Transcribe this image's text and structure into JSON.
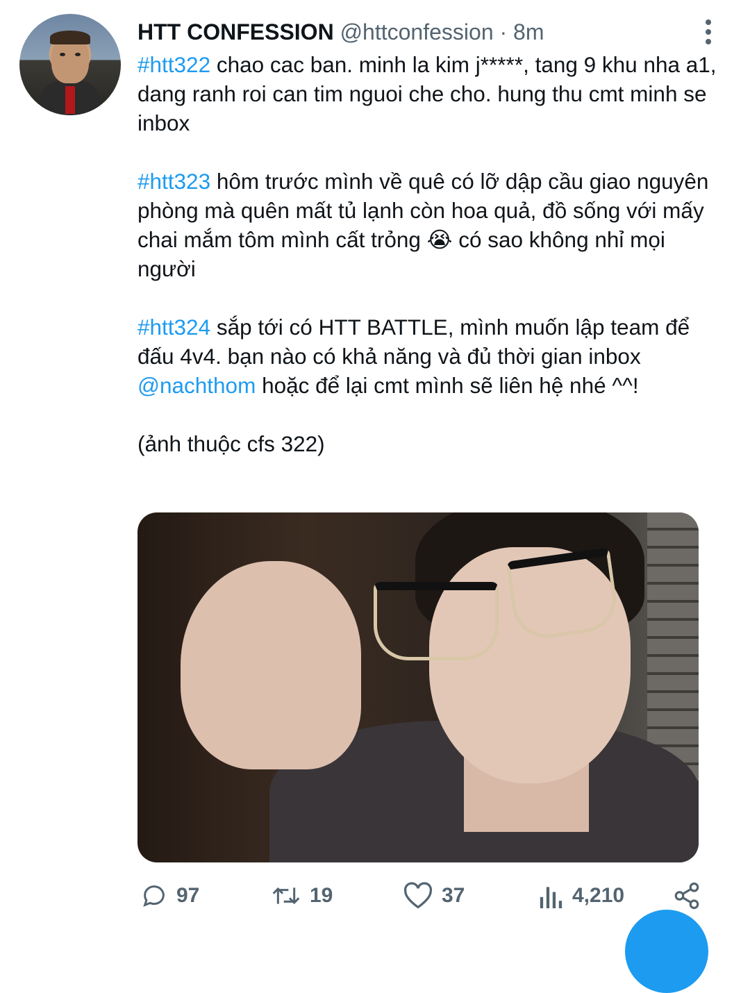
{
  "tweet": {
    "author_name": "HTT CONFESSION",
    "handle": "@httconfession",
    "separator": "·",
    "time": "8m",
    "paragraphs": [
      {
        "tag": "#htt322",
        "text": " chao cac ban. minh la kim j*****, tang 9 khu nha a1, dang ranh roi can tim nguoi che cho. hung thu cmt minh se inbox"
      },
      {
        "tag": "#htt323",
        "text": " hôm trước mình về quê có lỡ dập cầu giao nguyên phòng mà quên mất tủ lạnh còn hoa quả, đồ sống với mấy chai mắm tôm mình cất trỏng 😭 có sao không nhỉ mọi người"
      },
      {
        "tag": "#htt324",
        "text_before": " sắp tới có HTT BATTLE, mình muốn lập team để đấu 4v4. bạn nào có khả năng và đủ thời gian inbox ",
        "mention": "@nachthom",
        "text_after": " hoặc để lại cmt mình sẽ liên hệ nhé ^^!"
      },
      {
        "text": "(ảnh thuộc cfs 322)"
      }
    ]
  },
  "actions": {
    "replies": "97",
    "retweets": "19",
    "likes": "37",
    "views": "4,210"
  },
  "icons": [
    "more-vertical-icon",
    "reply-icon",
    "retweet-icon",
    "like-icon",
    "views-icon",
    "share-icon"
  ],
  "colors": {
    "link": "#1d9bf0",
    "secondary": "#536471",
    "text": "#0f1419"
  }
}
